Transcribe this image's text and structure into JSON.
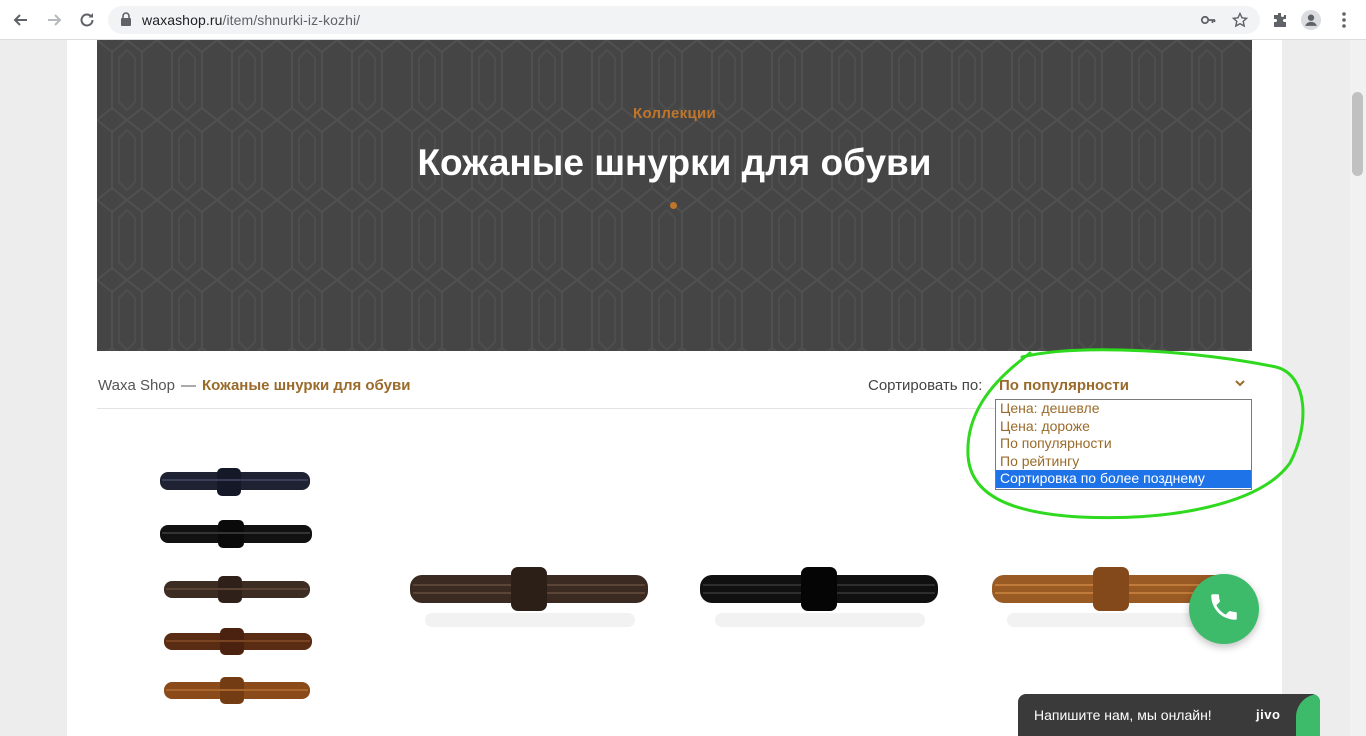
{
  "browser": {
    "url_domain": "waxashop.ru",
    "url_path": "/item/shnurki-iz-kozhi/"
  },
  "hero": {
    "eyebrow": "Коллекции",
    "title": "Кожаные шнурки для обуви"
  },
  "breadcrumb": {
    "home": "Waxa Shop",
    "separator": "—",
    "current": "Кожаные шнурки для обуви"
  },
  "sort": {
    "label": "Сортировать по:",
    "value": "По популярности",
    "options": [
      "Цена: дешевле",
      "Цена: дороже",
      "По популярности",
      "По рейтингу",
      "Сортировка по более позднему"
    ],
    "highlighted_index": 4
  },
  "chat": {
    "message": "Напишите нам, мы онлайн!",
    "brand": "jivo"
  },
  "colors": {
    "accent": "#c0762a",
    "hero_bg": "#454545",
    "call_green": "#3dbb6a",
    "annotation_green": "#2ed91e"
  }
}
